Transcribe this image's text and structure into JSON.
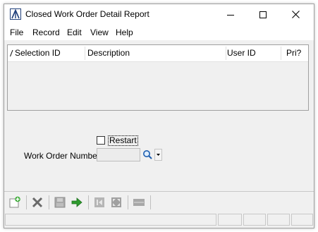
{
  "window": {
    "title": "Closed Work Order Detail Report",
    "app_icon": "a-logo-icon",
    "controls": [
      "minimize-icon",
      "maximize-icon",
      "close-icon"
    ]
  },
  "menu": {
    "items": [
      {
        "label": "File"
      },
      {
        "label": "Record"
      },
      {
        "label": "Edit"
      },
      {
        "label": "View"
      },
      {
        "label": "Help"
      }
    ]
  },
  "grid": {
    "columns": [
      {
        "label": "Selection ID"
      },
      {
        "label": "Description"
      },
      {
        "label": "User ID"
      },
      {
        "label": "Pri?"
      }
    ],
    "rows": []
  },
  "form": {
    "restart_label": "Restart",
    "restart_checked": false,
    "work_order_label": "Work Order Number:",
    "work_order_value": ""
  },
  "toolbar": {
    "buttons": [
      "new-record-icon",
      "delete-icon",
      "save-icon",
      "go-icon",
      "first-icon",
      "expand-icon",
      "list-icon"
    ]
  },
  "colors": {
    "window_bg": "#f0f0f0",
    "border": "#a0a0a0",
    "go_arrow": "#2e9b2e",
    "delete_x": "#6a6a6a"
  }
}
